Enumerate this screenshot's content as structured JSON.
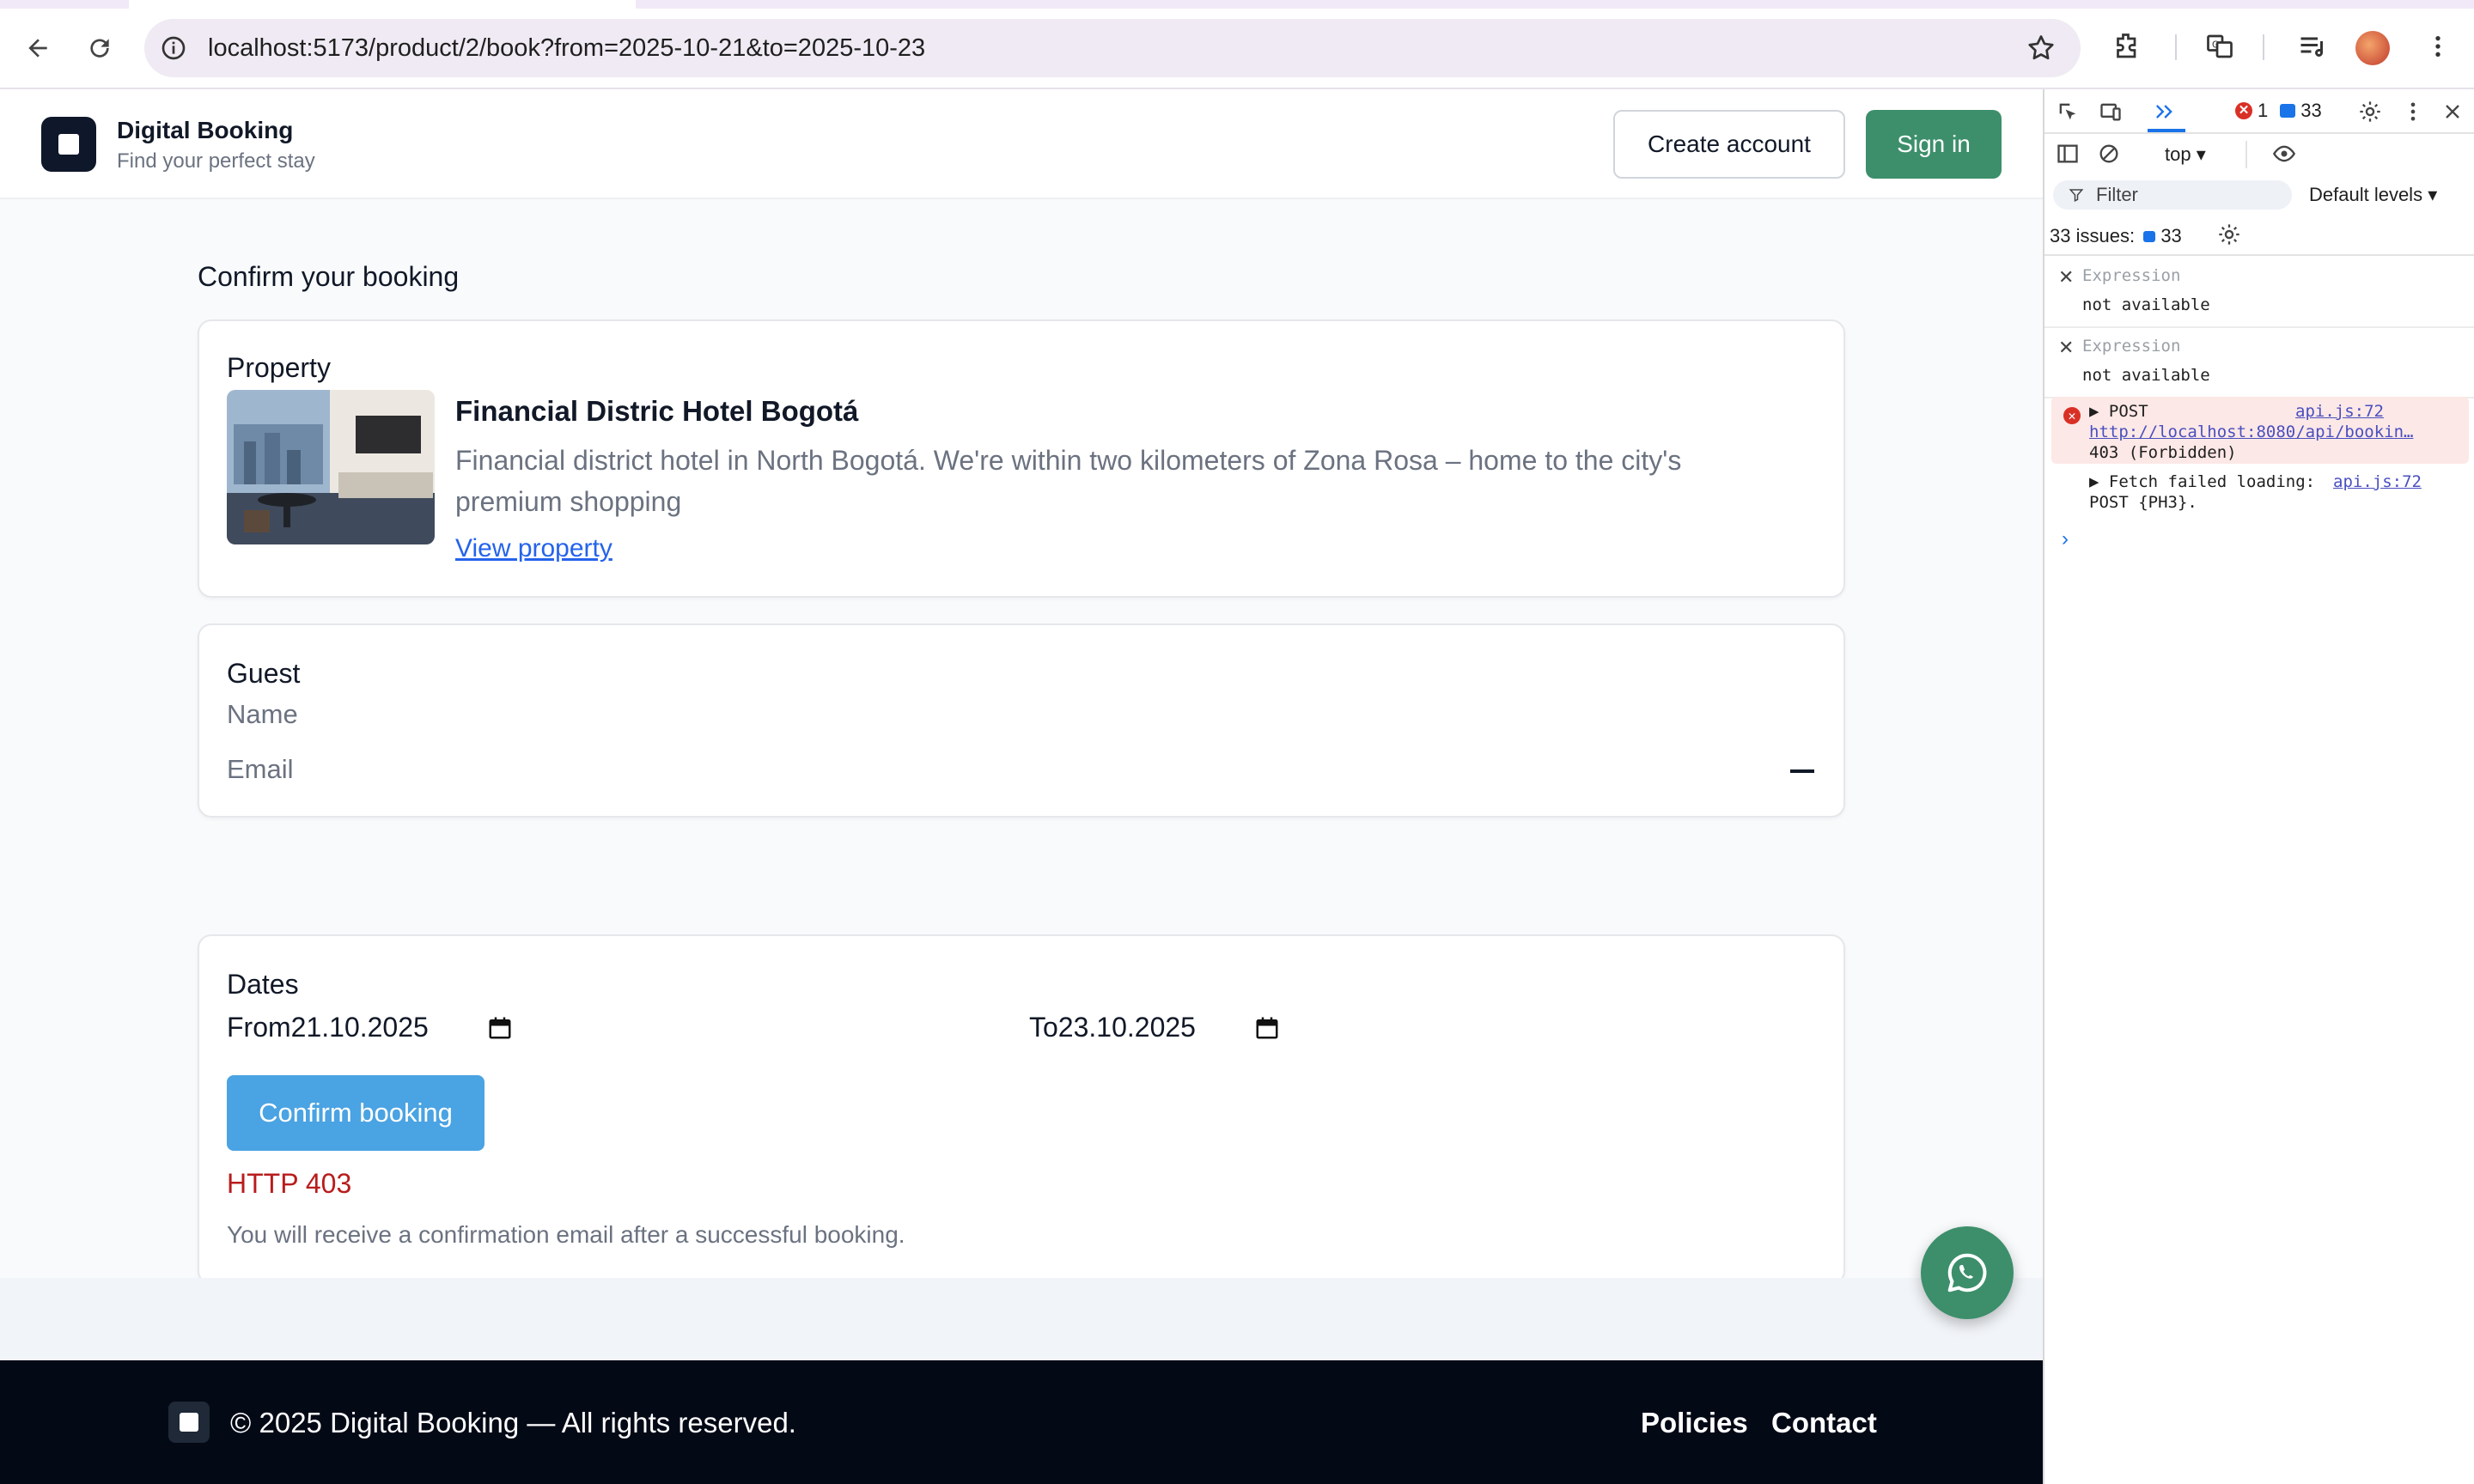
{
  "browser": {
    "url": "localhost:5173/product/2/book?from=2025-10-21&to=2025-10-23"
  },
  "header": {
    "brand_title": "Digital Booking",
    "brand_subtitle": "Find your perfect stay",
    "create_account": "Create account",
    "sign_in": "Sign in"
  },
  "main": {
    "title": "Confirm your booking",
    "property": {
      "heading": "Property",
      "name": "Financial Distric Hotel Bogotá",
      "description": "Financial district hotel in North Bogotá. We're within two kilometers of Zona Rosa – home to the city's premium shopping",
      "link": "View property"
    },
    "guest": {
      "heading": "Guest",
      "name_label": "Name",
      "email_label": "Email"
    },
    "dates": {
      "heading": "Dates",
      "from_label": "From",
      "from_value": "21.10.2025",
      "to_label": "To",
      "to_value": "23.10.2025",
      "confirm_button": "Confirm booking",
      "error": "HTTP 403",
      "note": "You will receive a confirmation email after a successful booking."
    }
  },
  "footer": {
    "copyright": "© 2025 Digital Booking — All rights reserved.",
    "links": [
      "Policies",
      "Contact"
    ]
  },
  "devtools": {
    "error_count": "1",
    "message_count": "33",
    "context": "top",
    "filter_placeholder": "Filter",
    "levels": "Default levels",
    "issues_label": "33 issues:",
    "issues_count": "33",
    "expressions": [
      {
        "label": "Expression",
        "value": "not available"
      },
      {
        "label": "Expression",
        "value": "not available"
      }
    ],
    "console": {
      "error_method": "POST",
      "error_source": "api.js:72",
      "error_url": "http://localhost:8080/api/bookin…",
      "error_status": "403 (Forbidden)",
      "fetch_text": "Fetch failed loading:",
      "fetch_source": "api.js:72",
      "fetch_detail": "POST {PH3}."
    }
  },
  "colors": {
    "brand_green": "#3c8f6a",
    "confirm_blue": "#4aa3e2",
    "error_red": "#b91c1c",
    "footer_bg": "#040916"
  }
}
